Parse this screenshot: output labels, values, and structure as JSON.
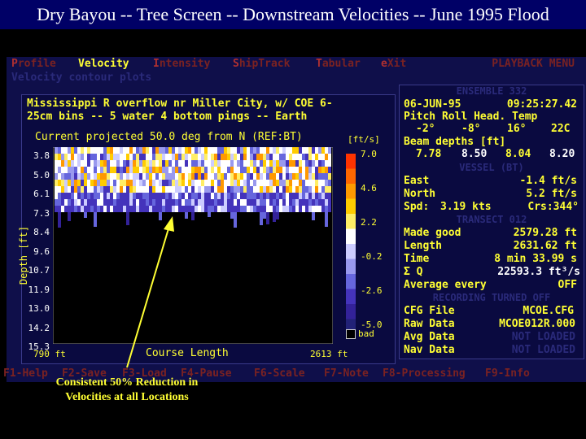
{
  "slide": {
    "title": "Dry Bayou -- Tree Screen -- Downstream Velocities -- June 1995 Flood",
    "annotation": "Consistent 50% Reduction in Velocities at all Locations"
  },
  "menu": {
    "items": [
      {
        "hot": "P",
        "rest": "rofile"
      },
      {
        "hot": "V",
        "rest": "elocity"
      },
      {
        "hot": "I",
        "rest": "ntensity"
      },
      {
        "hot": "S",
        "rest": "hipTrack"
      },
      {
        "hot": "T",
        "rest": "abular"
      },
      {
        "hot": "e",
        "rest": "Xit"
      }
    ],
    "active_index": 1,
    "right_label": "PLAYBACK MENU",
    "submenu": "Velocity contour plots"
  },
  "plot": {
    "header_line1": "Mississippi R overflow nr Miller City, w/ COE 6-",
    "header_line2": "25cm bins -- 5 water 4 bottom pings -- Earth",
    "subtitle": "Current projected 50.0 deg from N (REF:BT)",
    "units": "[ft/s]",
    "ylabel": "Depth [ft]",
    "xlabel": "Course Length",
    "x_start": "790 ft",
    "x_end": "2613 ft",
    "depth_ticks": [
      "3.8",
      "5.0",
      "6.1",
      "7.3",
      "8.4",
      "9.6",
      "10.7",
      "11.9",
      "13.0",
      "14.2",
      "15.3"
    ],
    "colorbar_ticks": [
      "7.0",
      "4.6",
      "2.2",
      "-0.2",
      "-2.6",
      "-5.0"
    ],
    "bad_label": "bad"
  },
  "colors": {
    "screen_bg": "#0f0f4a",
    "text_yellow": "#ffff33",
    "menu_red": "#7a2222",
    "dim_blue": "#2a2a7a",
    "arrow": "#ffff33"
  },
  "ensemble": {
    "header": "ENSEMBLE 332",
    "date": "06-JUN-95",
    "time": "09:25:27.42",
    "attitude_labels": "Pitch Roll  Head. Temp",
    "pitch": "-2°",
    "roll": "-8°",
    "heading": "16°",
    "temp": "22C",
    "beam_label": "Beam depths [ft]",
    "beams": [
      "7.78",
      "8.50",
      "8.04",
      "8.20"
    ]
  },
  "vessel": {
    "header": "VESSEL (BT)",
    "east_label": "East",
    "east_value": "-1.4 ft/s",
    "north_label": "North",
    "north_value": "5.2 ft/s",
    "spd_label": "Spd:",
    "spd_value": "3.19 kts",
    "crs_value": "Crs:344°"
  },
  "transect": {
    "header": "TRANSECT 012",
    "made_good_label": "Made good",
    "made_good_value": "2579.28 ft",
    "length_label": "Length",
    "length_value": "2631.62 ft",
    "time_label": "Time",
    "time_value": "8 min 33.99 s",
    "q_label": "Σ Q",
    "q_value": "22593.3 ft³/s",
    "avg_label": "Average every",
    "avg_value": "OFF"
  },
  "recording": {
    "header": "RECORDING TURNED OFF",
    "cfg_label": "CFG File",
    "cfg_value": "MCOE.CFG",
    "raw_label": "Raw Data",
    "raw_value": "MCOE012R.000",
    "avg_label": "Avg Data",
    "avg_value": "NOT LOADED",
    "nav_label": "Nav Data",
    "nav_value": "NOT LOADED"
  },
  "function_keys": [
    {
      "key": "F1",
      "label": "-Help"
    },
    {
      "key": "F2",
      "label": "-Save"
    },
    {
      "key": "F3",
      "label": "-Load"
    },
    {
      "key": "F4",
      "label": "-Pause"
    },
    {
      "key": "F6",
      "label": "-Scale"
    },
    {
      "key": "F7",
      "label": "-Note"
    },
    {
      "key": "F8",
      "label": "-Processing"
    },
    {
      "key": "F9",
      "label": "-Info"
    }
  ]
}
